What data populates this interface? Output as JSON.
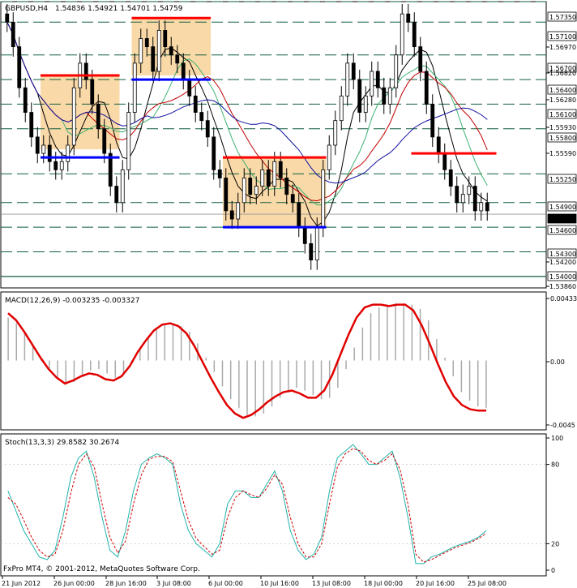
{
  "header": {
    "symbol": "GBPUSD,H4",
    "ohlc": "1.54836 1.54921 1.54701 1.54759"
  },
  "footer": {
    "copyright": "FxPro MT4, © 2001-2012, MetaQuotes Software Corp."
  },
  "colors": {
    "candle": "#000000",
    "rect_fill": "#fad9a8",
    "level_red": "#ff0000",
    "level_blue": "#0000ff",
    "sr_line": "#0f5f3f",
    "macd_line": "#e00000",
    "macd_hist": "#a9a9a9",
    "stoch_main": "#20b2aa",
    "stoch_signal": "#d00000",
    "ma_black": "#000000",
    "ma_green": "#3cb371",
    "ma_red": "#c00000",
    "ma_blue": "#1010a0"
  },
  "chart_data": [
    {
      "panel": "price",
      "type": "candlestick",
      "title": "GBPUSD,H4",
      "ylim": [
        1.5386,
        1.5735
      ],
      "y_tick_labels": [
        "1.57350",
        "1.57100",
        "1.56970",
        "1.56700",
        "1.56820",
        "1.56400",
        "1.56280",
        "1.56100",
        "1.55930",
        "1.55800",
        "1.55590",
        "1.55250",
        "1.54900",
        "1.54759",
        "1.54600",
        "1.54300",
        "1.54200",
        "1.54000",
        "1.53860"
      ],
      "levels_dashed": [
        1.5735,
        1.571,
        1.567,
        1.564,
        1.561,
        1.558,
        1.5525,
        1.549,
        1.546,
        1.543
      ],
      "level_solid": 1.54,
      "current_price": 1.54759,
      "closes": [
        1.571,
        1.568,
        1.563,
        1.56,
        1.557,
        1.555,
        1.556,
        1.554,
        1.553,
        1.554,
        1.556,
        1.563,
        1.566,
        1.564,
        1.561,
        1.558,
        1.555,
        1.551,
        1.549,
        1.553,
        1.56,
        1.566,
        1.569,
        1.568,
        1.565,
        1.57,
        1.568,
        1.567,
        1.566,
        1.564,
        1.562,
        1.56,
        1.559,
        1.557,
        1.553,
        1.552,
        1.548,
        1.547,
        1.549,
        1.552,
        1.55,
        1.551,
        1.553,
        1.551,
        1.554,
        1.552,
        1.55,
        1.549,
        1.546,
        1.544,
        1.542,
        1.546,
        1.553,
        1.556,
        1.559,
        1.562,
        1.566,
        1.564,
        1.56,
        1.562,
        1.565,
        1.563,
        1.561,
        1.563,
        1.567,
        1.572,
        1.571,
        1.568,
        1.565,
        1.561,
        1.557,
        1.555,
        1.553,
        1.551,
        1.549,
        1.55,
        1.551,
        1.548,
        1.549,
        1.548
      ],
      "boxes": [
        {
          "from": 6,
          "to": 18,
          "top": 1.5645,
          "bottom": 1.5555
        },
        {
          "from": 21,
          "to": 33,
          "top": 1.5715,
          "bottom": 1.5645
        },
        {
          "from": 36,
          "to": 52,
          "top": 1.5545,
          "bottom": 1.546
        }
      ],
      "red_levels": [
        {
          "from": 6,
          "to": 18,
          "value": 1.5645
        },
        {
          "from": 21,
          "to": 33,
          "value": 1.5715
        },
        {
          "from": 36,
          "to": 52,
          "value": 1.5545
        },
        {
          "from": 67,
          "to": 80,
          "value": 1.555
        }
      ],
      "blue_levels": [
        {
          "from": 6,
          "to": 18,
          "value": 1.5545
        },
        {
          "from": 21,
          "to": 33,
          "value": 1.564
        },
        {
          "from": 36,
          "to": 52,
          "value": 1.546
        }
      ]
    },
    {
      "panel": "macd",
      "type": "bar",
      "title": "MACD(12,26,9) -0.003235 -0.003327",
      "ylim": [
        -0.0045,
        0.00433
      ],
      "y_tick_labels": [
        "0.00433",
        "0.00",
        "-0.0045"
      ],
      "histogram": [
        0.003,
        0.0026,
        0.0019,
        0.001,
        0.0002,
        -0.0007,
        -0.0013,
        -0.0017,
        -0.0015,
        -0.001,
        -0.0007,
        -0.0006,
        -0.0009,
        -0.0012,
        -0.001,
        -0.0002,
        0.0008,
        0.0017,
        0.0022,
        0.0025,
        0.0026,
        0.0024,
        0.002,
        0.0012,
        0.0002,
        -0.0008,
        -0.0018,
        -0.0027,
        -0.0033,
        -0.0038,
        -0.0039,
        -0.0037,
        -0.0032,
        -0.0026,
        -0.0021,
        -0.0019,
        -0.0021,
        -0.0024,
        -0.0027,
        -0.0026,
        -0.0019,
        -0.0006,
        0.0009,
        0.0023,
        0.0033,
        0.0037,
        0.0039,
        0.004,
        0.004,
        0.0039,
        0.0036,
        0.0028,
        0.0015,
        0.0002,
        -0.0011,
        -0.0022,
        -0.0028,
        -0.0032,
        -0.0033
      ],
      "signal": [
        0.0033,
        0.0028,
        0.002,
        0.0011,
        0.0002,
        -0.0006,
        -0.0012,
        -0.0016,
        -0.0014,
        -0.0011,
        -0.0009,
        -0.001,
        -0.0013,
        -0.0014,
        -0.0011,
        -0.0004,
        0.0006,
        0.0014,
        0.0021,
        0.0025,
        0.0026,
        0.0024,
        0.0019,
        0.001,
        -0.0001,
        -0.0012,
        -0.0022,
        -0.0031,
        -0.0037,
        -0.004,
        -0.0038,
        -0.0034,
        -0.0029,
        -0.0025,
        -0.0022,
        -0.0021,
        -0.0023,
        -0.0026,
        -0.0026,
        -0.0021,
        -0.001,
        0.0004,
        0.0018,
        0.003,
        0.0037,
        0.0039,
        0.0039,
        0.0038,
        0.0039,
        0.0039,
        0.0035,
        0.0025,
        0.0012,
        -0.0002,
        -0.0015,
        -0.0025,
        -0.0031,
        -0.0034,
        -0.0035,
        -0.0035
      ]
    },
    {
      "panel": "stochastic",
      "type": "line",
      "title": "Stoch(13,3,3) 29.8582 30.2674",
      "ylim": [
        0,
        100
      ],
      "y_tick_labels": [
        "100",
        "80",
        "20",
        "0"
      ],
      "main": [
        60,
        45,
        30,
        20,
        10,
        8,
        15,
        40,
        70,
        85,
        90,
        70,
        40,
        15,
        10,
        30,
        60,
        80,
        85,
        88,
        85,
        80,
        50,
        30,
        20,
        15,
        10,
        20,
        50,
        60,
        60,
        55,
        55,
        65,
        75,
        60,
        30,
        15,
        8,
        12,
        25,
        60,
        85,
        90,
        95,
        88,
        80,
        80,
        85,
        90,
        70,
        40,
        5,
        5,
        10,
        12,
        15,
        18,
        20,
        22,
        25,
        30
      ],
      "signal": [
        55,
        50,
        38,
        25,
        15,
        10,
        12,
        30,
        58,
        80,
        88,
        78,
        50,
        25,
        13,
        22,
        50,
        72,
        84,
        86,
        86,
        82,
        60,
        38,
        24,
        18,
        12,
        15,
        40,
        55,
        60,
        57,
        55,
        62,
        72,
        65,
        40,
        20,
        10,
        10,
        20,
        50,
        78,
        88,
        92,
        90,
        83,
        80,
        83,
        88,
        76,
        50,
        12,
        6,
        8,
        11,
        14,
        17,
        19,
        21,
        24,
        28
      ]
    }
  ],
  "x_axis_labels": [
    "21 Jun 2012",
    "26 Jun 00:00",
    "28 Jun 16:00",
    "3 Jul 08:00",
    "6 Jul 00:00",
    "10 Jul 16:00",
    "13 Jul 08:00",
    "18 Jul 00:00",
    "20 Jul 16:00",
    "25 Jul 08:00"
  ]
}
